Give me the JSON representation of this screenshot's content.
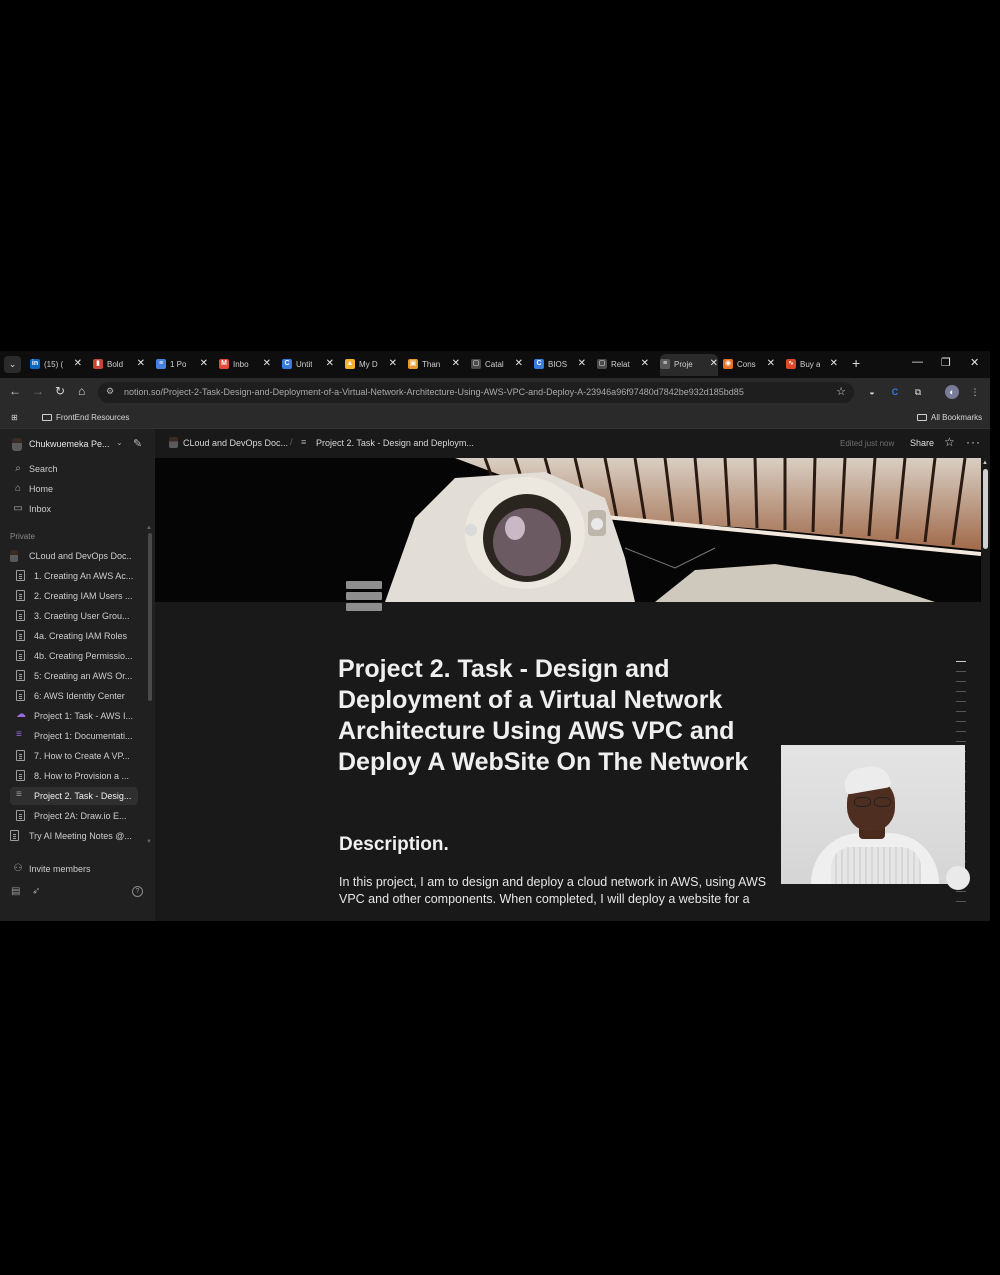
{
  "browser": {
    "tabs": [
      {
        "label": "(15) (",
        "icon": "linkedin-icon",
        "color": "#0a66c2",
        "glyph": "in"
      },
      {
        "label": "Bold",
        "icon": "bookmark-icon",
        "color": "#c94434",
        "glyph": "▮"
      },
      {
        "label": "1 Po",
        "icon": "docs-icon",
        "color": "#4a7fe0",
        "glyph": "≡"
      },
      {
        "label": "Inbo",
        "icon": "gmail-icon",
        "color": "#e24a3b",
        "glyph": "M"
      },
      {
        "label": "Untit",
        "icon": "c-logo-icon",
        "color": "#3a7be0",
        "glyph": "C"
      },
      {
        "label": "My D",
        "icon": "google-drive-icon",
        "color": "#f1b62a",
        "glyph": "▲"
      },
      {
        "label": "Than",
        "icon": "app-icon",
        "color": "#e89a2a",
        "glyph": "▣"
      },
      {
        "label": "Catal",
        "icon": "page-icon",
        "color": "#4a4a4a",
        "glyph": "▢"
      },
      {
        "label": "BIOS",
        "icon": "c-logo-icon",
        "color": "#3a7be0",
        "glyph": "C"
      },
      {
        "label": "Relat",
        "icon": "page-icon",
        "color": "#4a4a4a",
        "glyph": "▢"
      },
      {
        "label": "Proje",
        "icon": "notion-list-icon",
        "color": "#5a5a5a",
        "glyph": "≡"
      },
      {
        "label": "Cons",
        "icon": "app-icon",
        "color": "#e4722a",
        "glyph": "◉"
      },
      {
        "label": "Buy a",
        "icon": "app-icon",
        "color": "#d94a2a",
        "glyph": "∿"
      }
    ],
    "url": "notion.so/Project-2-Task-Design-and-Deployment-of-a-Virtual-Network-Architecture-Using-AWS-VPC-and-Deploy-A-23946a96f97480d7842be932d185bd85",
    "bookmarks": {
      "left": "FrontEnd Resources",
      "right": "All Bookmarks"
    }
  },
  "sidebar": {
    "workspace_name": "Chukwuemeka Pe...",
    "search": "Search",
    "home": "Home",
    "inbox": "Inbox",
    "private_label": "Private",
    "pages": [
      {
        "label": "CLoud and DevOps Doc...",
        "type": "avatar"
      },
      {
        "label": "1. Creating An AWS Ac...",
        "type": "doc"
      },
      {
        "label": "2. Creating IAM Users ...",
        "type": "doc"
      },
      {
        "label": "3. Craeting User Grou...",
        "type": "doc"
      },
      {
        "label": "4a. Creating IAM Roles",
        "type": "doc"
      },
      {
        "label": "4b. Creating Permissio...",
        "type": "doc"
      },
      {
        "label": "5: Creating an AWS Or...",
        "type": "doc"
      },
      {
        "label": "6: AWS Identity Center",
        "type": "doc"
      },
      {
        "label": "Project 1: Task - AWS I...",
        "type": "cloud"
      },
      {
        "label": "Project 1: Documentati...",
        "type": "list-purple"
      },
      {
        "label": "7. How to Create A VP...",
        "type": "doc"
      },
      {
        "label": "8. How to Provision a ...",
        "type": "doc"
      },
      {
        "label": "Project 2. Task - Desig...",
        "type": "list",
        "selected": true
      },
      {
        "label": "Project 2A: Draw.io E...",
        "type": "doc"
      },
      {
        "label": "Try AI Meeting Notes @...",
        "type": "doc"
      }
    ],
    "invite": "Invite members"
  },
  "topbar": {
    "crumb_1": "CLoud and DevOps Doc...",
    "crumb_2": "Project 2. Task - Design and Deploym...",
    "edited": "Edited just now",
    "share": "Share"
  },
  "page": {
    "title": "Project 2. Task - Design and Deployment of a Virtual Network Architecture Using AWS VPC and Deploy A WebSite On The Network",
    "heading": "Description.",
    "paragraph": "In this project, I am to design and deploy a cloud network in AWS, using AWS VPC and other components. When completed, I will deploy a website for a"
  },
  "colors": {
    "app_bg": "#191919",
    "sidebar_bg": "#202020",
    "accent_purple": "#9c6ade"
  }
}
